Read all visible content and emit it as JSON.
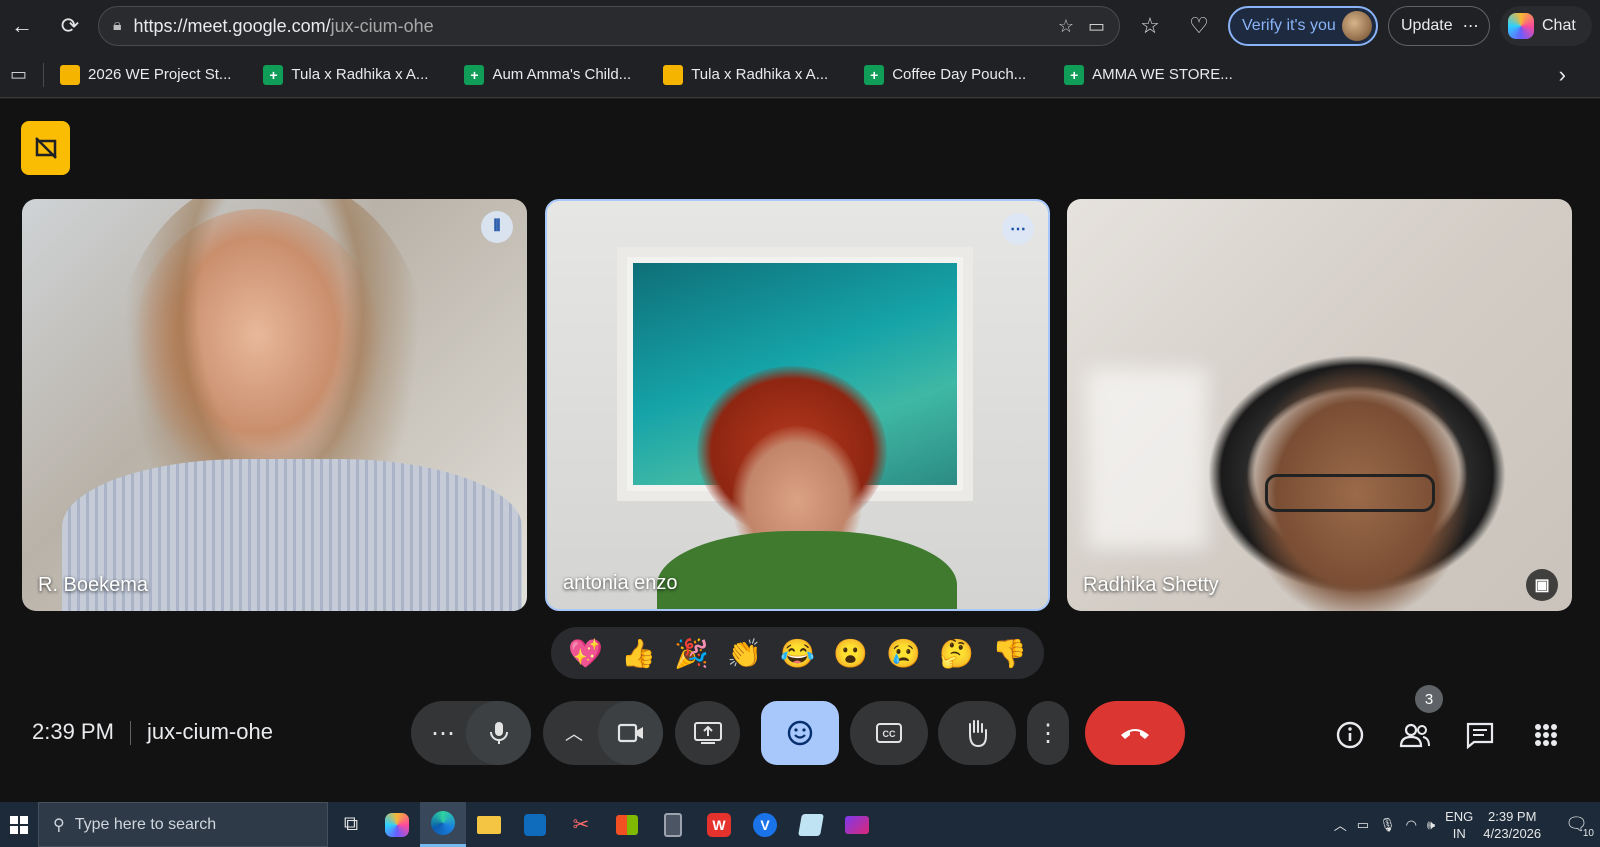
{
  "browser": {
    "url_host": "https://meet.google.com/",
    "url_path": "jux-cium-ohe",
    "verify_label": "Verify it's you",
    "update_label": "Update",
    "chat_label": "Chat"
  },
  "bookmarks": [
    {
      "label": "2026 WE Project St...",
      "type": "slides"
    },
    {
      "label": "Tula x Radhika x A...",
      "type": "sheets"
    },
    {
      "label": "Aum Amma's Child...",
      "type": "sheets"
    },
    {
      "label": "Tula x Radhika x A...",
      "type": "slides"
    },
    {
      "label": "Coffee Day Pouch...",
      "type": "sheets"
    },
    {
      "label": "AMMA WE STORE...",
      "type": "sheets"
    }
  ],
  "participants": [
    {
      "name": "R. Boekema"
    },
    {
      "name": "antonia enzo"
    },
    {
      "name": "Radhika Shetty"
    }
  ],
  "reactions": [
    "💖",
    "👍",
    "🎉",
    "👏",
    "😂",
    "😮",
    "😢",
    "🤔",
    "👎"
  ],
  "controls": {
    "time": "2:39 PM",
    "meeting_code": "jux-cium-ohe",
    "people_count": "3"
  },
  "taskbar": {
    "search_placeholder": "Type here to search",
    "lang_top": "ENG",
    "lang_bottom": "IN",
    "clock_time": "2:39 PM",
    "clock_date": "4/23/2026",
    "notif_count": "10"
  },
  "colors": {
    "meet_bg": "#121212",
    "hangup": "#dc3633",
    "active_control": "#a8c7fa",
    "badge": "#fbbc04"
  }
}
